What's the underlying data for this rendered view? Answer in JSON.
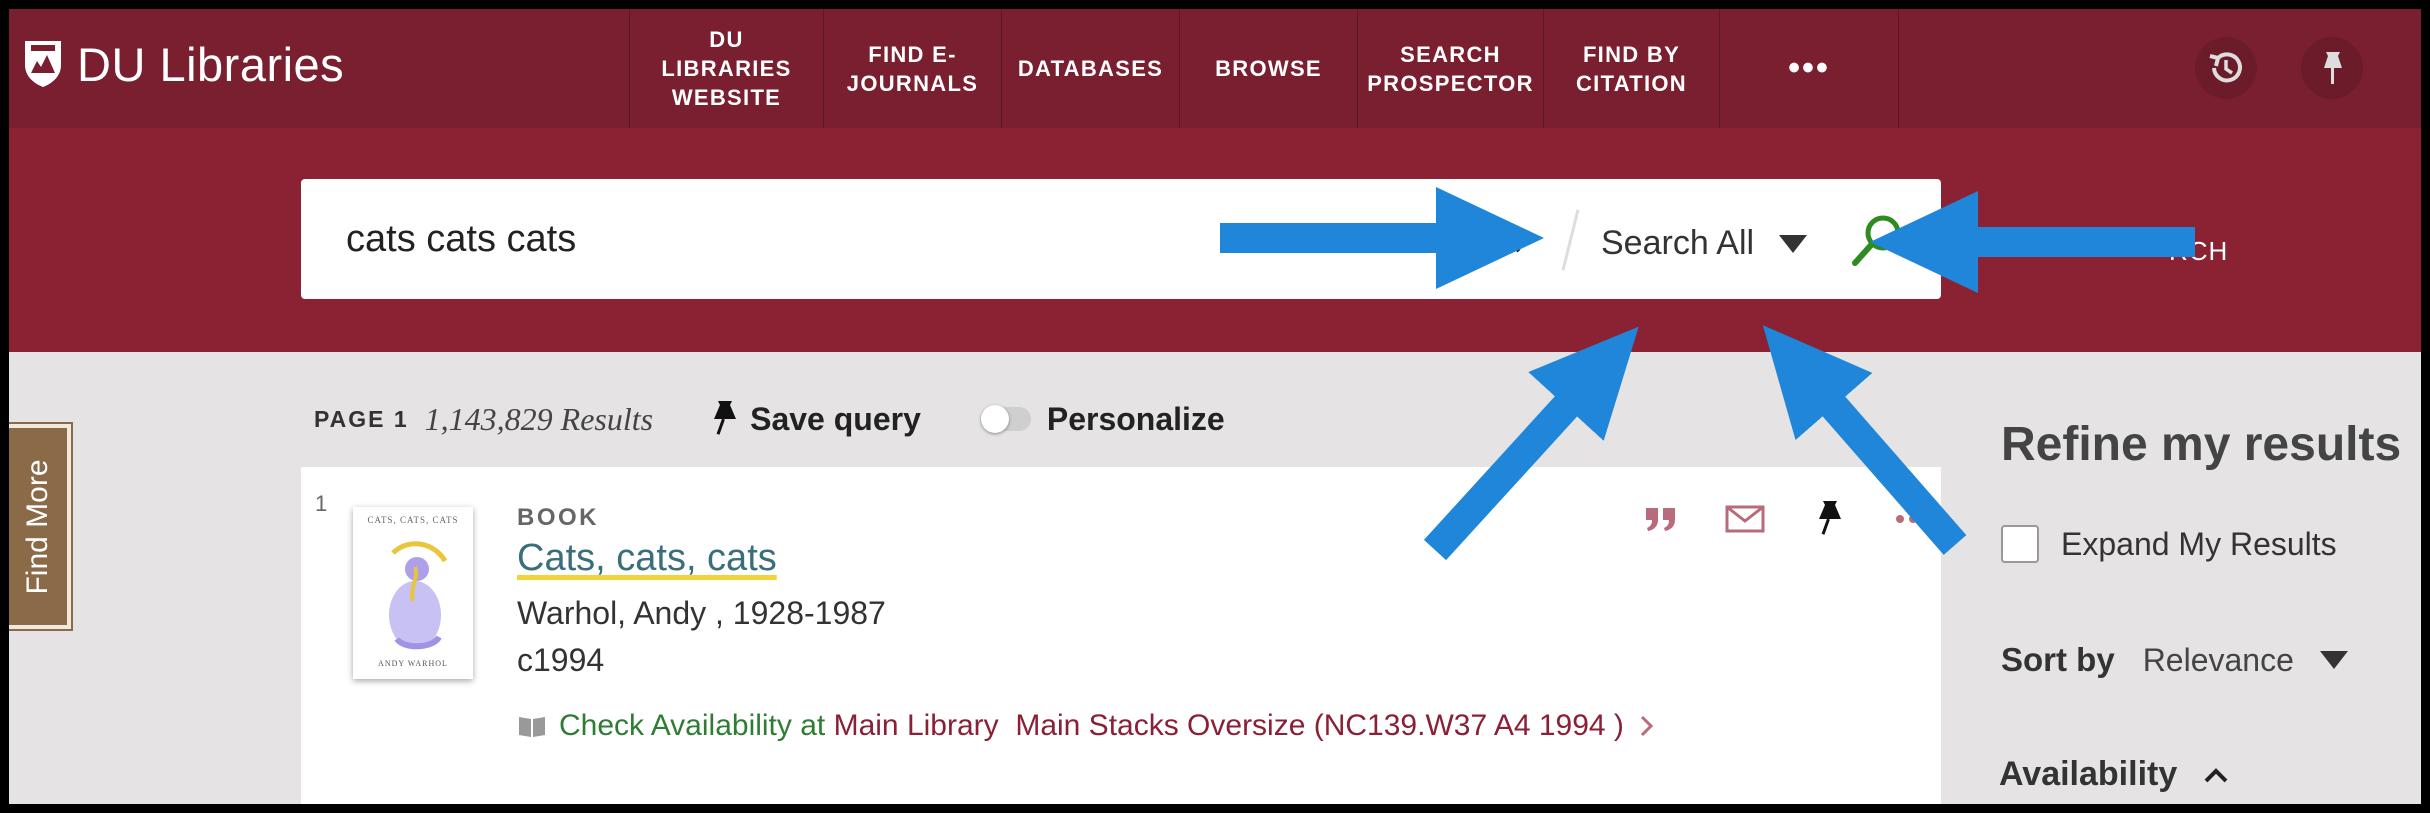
{
  "app": {
    "name": "DU Libraries"
  },
  "nav": {
    "links": [
      {
        "label": "DU\nLIBRARIES\nWEBSITE"
      },
      {
        "label": "FIND E-\nJOURNALS"
      },
      {
        "label": "DATABASES"
      },
      {
        "label": "BROWSE"
      },
      {
        "label": "SEARCH\nPROSPECTOR"
      },
      {
        "label": "FIND BY\nCITATION"
      }
    ],
    "more_label": "•••",
    "history_icon": "history-icon",
    "pin_icon": "pin-icon"
  },
  "search": {
    "query": "cats cats cats",
    "scope": "Search All",
    "advanced_partial": "RCH"
  },
  "results": {
    "page_label": "PAGE 1",
    "count": "1,143,829 Results",
    "save_query": "Save query",
    "personalize": "Personalize",
    "items": [
      {
        "index": "1",
        "type": "BOOK",
        "title": "Cats, cats, cats",
        "author": "Warhol, Andy , 1928-1987",
        "date": "c1994",
        "availability_prefix": "Check Availability at",
        "location": "Main Library  Main Stacks Oversize (NC139.W37 A4 1994 )",
        "thumb_title": "CATS, CATS, CATS",
        "thumb_author": "ANDY WARHOL"
      }
    ]
  },
  "side_tab": {
    "label": "Find More"
  },
  "sidebar": {
    "title": "Refine my results",
    "expand_label": "Expand My Results",
    "sort_label": "Sort by",
    "sort_value": "Relevance",
    "availability_label": "Availability"
  },
  "colors": {
    "topbar": "#7a1f30",
    "searchband": "#8a2234",
    "arrow": "#1f86d9",
    "search_icon": "#2e8b1f",
    "link_title": "#3a6e7d",
    "available_green": "#2e7d32"
  }
}
